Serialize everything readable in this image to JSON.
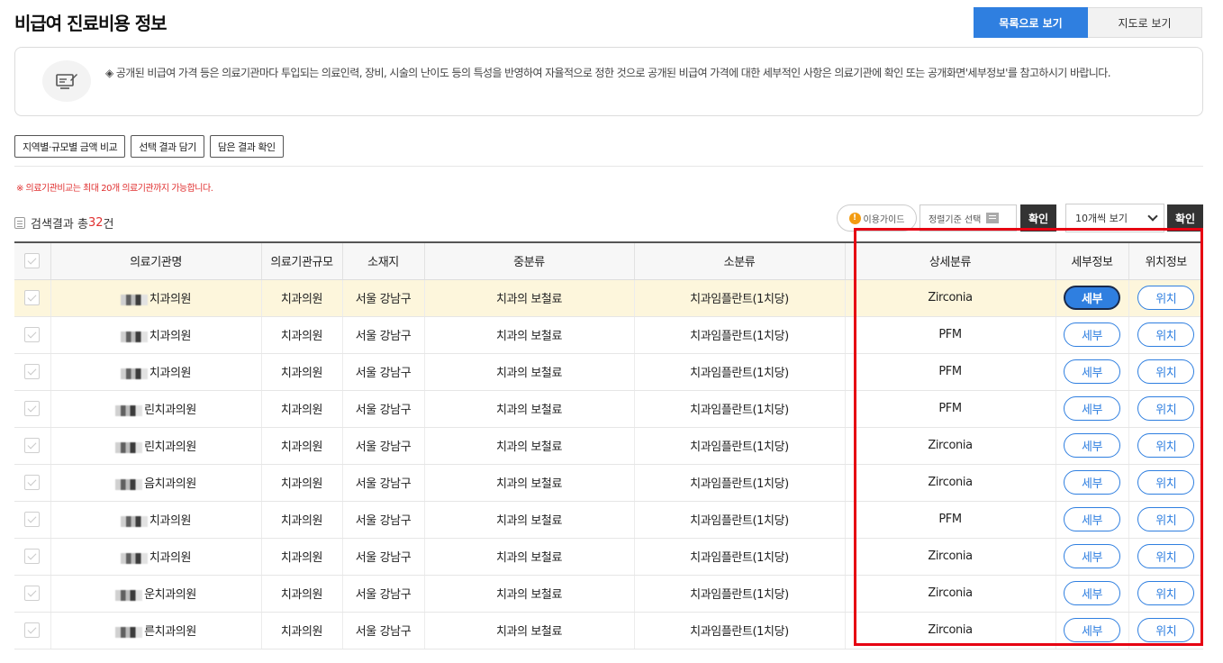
{
  "page": {
    "title": "비급여 진료비용 정보"
  },
  "view_toggle": {
    "list_label": "목록으로 보기",
    "map_label": "지도로 보기"
  },
  "notice": {
    "text": "◈ 공개된 비급여 가격 등은 의료기관마다 투입되는 의료인력, 장비, 시술의 난이도 등의 특성을 반영하여 자율적으로 정한 것으로 공개된 비급여 가격에 대한 세부적인 사항은 의료기관에 확인 또는 공개화면'세부정보'를 참고하시기 바랍니다.",
    "icon": "monitor-edit-icon"
  },
  "actions": {
    "region_compare": "지역별·규모별 금액 비교",
    "save_selected": "선택 결과 담기",
    "view_saved": "담은 결과 확인"
  },
  "compare_note": "※ 의료기관비교는 최대 20개 의료기관까지 가능합니다.",
  "results": {
    "prefix": "검색결과 총",
    "count": "32",
    "suffix": "건"
  },
  "toolbar": {
    "guide": "이용가이드",
    "guide_icon_char": "!",
    "sort_placeholder": "정렬기준 선택",
    "confirm": "확인",
    "page_size": "10개씩 보기"
  },
  "table": {
    "headers": [
      "의료기관명",
      "의료기관규모",
      "소재지",
      "중분류",
      "소분류",
      "상세분류",
      "세부정보",
      "위치정보"
    ],
    "detail_label": "세부",
    "location_label": "위치",
    "rows": [
      {
        "name": "치과의원",
        "size": "치과의원",
        "location": "서울 강남구",
        "mid": "치과의 보철료",
        "sub": "치과임플란트(1치당)",
        "detail": "Zirconia"
      },
      {
        "name": "치과의원",
        "size": "치과의원",
        "location": "서울 강남구",
        "mid": "치과의 보철료",
        "sub": "치과임플란트(1치당)",
        "detail": "PFM"
      },
      {
        "name": "치과의원",
        "size": "치과의원",
        "location": "서울 강남구",
        "mid": "치과의 보철료",
        "sub": "치과임플란트(1치당)",
        "detail": "PFM"
      },
      {
        "name": "린치과의원",
        "size": "치과의원",
        "location": "서울 강남구",
        "mid": "치과의 보철료",
        "sub": "치과임플란트(1치당)",
        "detail": "PFM"
      },
      {
        "name": "린치과의원",
        "size": "치과의원",
        "location": "서울 강남구",
        "mid": "치과의 보철료",
        "sub": "치과임플란트(1치당)",
        "detail": "Zirconia"
      },
      {
        "name": "음치과의원",
        "size": "치과의원",
        "location": "서울 강남구",
        "mid": "치과의 보철료",
        "sub": "치과임플란트(1치당)",
        "detail": "Zirconia"
      },
      {
        "name": "치과의원",
        "size": "치과의원",
        "location": "서울 강남구",
        "mid": "치과의 보철료",
        "sub": "치과임플란트(1치당)",
        "detail": "PFM"
      },
      {
        "name": "치과의원",
        "size": "치과의원",
        "location": "서울 강남구",
        "mid": "치과의 보철료",
        "sub": "치과임플란트(1치당)",
        "detail": "Zirconia"
      },
      {
        "name": "운치과의원",
        "size": "치과의원",
        "location": "서울 강남구",
        "mid": "치과의 보철료",
        "sub": "치과임플란트(1치당)",
        "detail": "Zirconia"
      },
      {
        "name": "른치과의원",
        "size": "치과의원",
        "location": "서울 강남구",
        "mid": "치과의 보철료",
        "sub": "치과임플란트(1치당)",
        "detail": "Zirconia"
      }
    ]
  },
  "colors": {
    "accent": "#2f7fe0",
    "highlight_row": "#fdf6dc",
    "annotation_box": "#e60012",
    "note_red": "#e03030"
  }
}
